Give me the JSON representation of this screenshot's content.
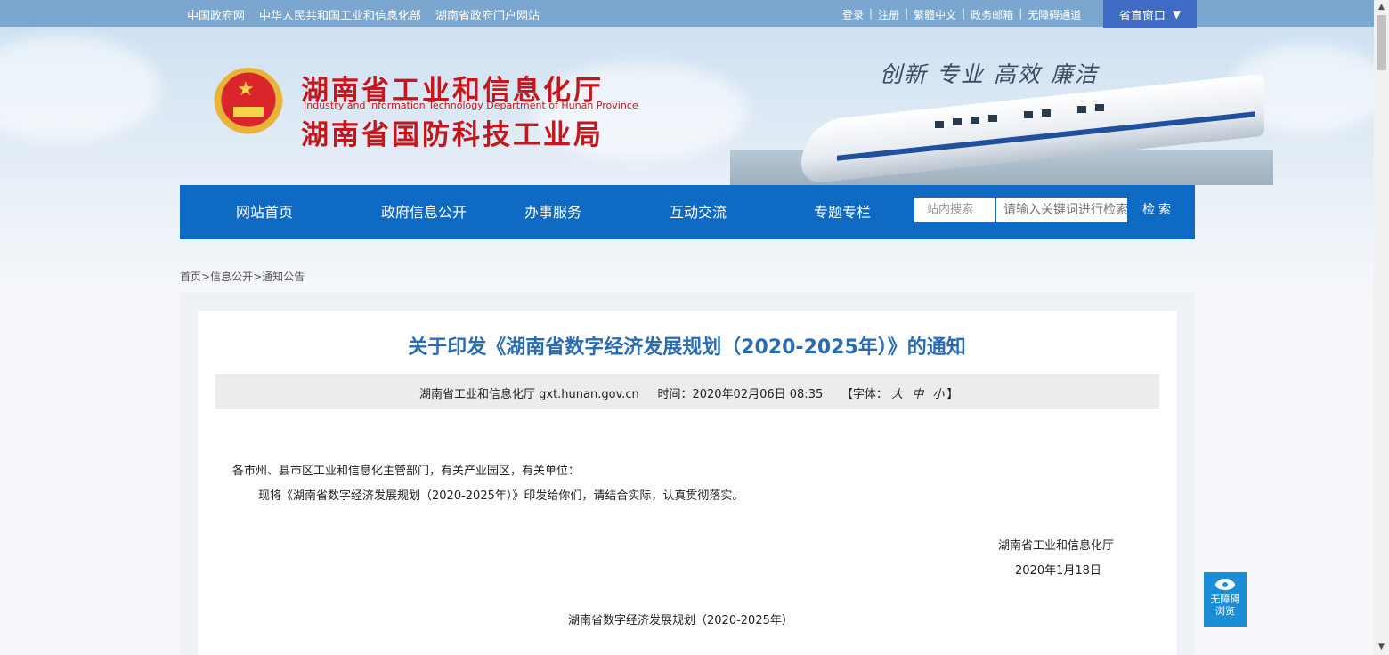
{
  "topbar": {
    "links": [
      "中国政府网",
      "中华人民共和国工业和信息化部",
      "湖南省政府门户网站"
    ],
    "right_links": [
      "登录",
      "注册",
      "繁體中文",
      "政务邮箱",
      "无障碍通道"
    ],
    "separator": "|",
    "province_button": "省直窗口",
    "province_arrow": "▼"
  },
  "header": {
    "title_cn_1": "湖南省工业和信息化厅",
    "title_en": "Industry and Information Technology Department of Hunan Province",
    "title_cn_2": "湖南省国防科技工业局",
    "slogan": "创新 专业 高效 廉洁",
    "emblem_icon": "national-emblem-icon",
    "emblem_star": "★"
  },
  "nav": {
    "items": [
      "网站首页",
      "政府信息公开",
      "办事服务",
      "互动交流",
      "专题专栏"
    ],
    "search_label": "站内搜索",
    "search_placeholder": "请输入关键词进行检索",
    "search_button": "检索"
  },
  "breadcrumb": {
    "home": "首页",
    "sep": ">",
    "level1": "信息公开",
    "level2": "通知公告"
  },
  "article": {
    "title": "关于印发《湖南省数字经济发展规划（2020-2025年）》的通知",
    "source": "湖南省工业和信息化厅 gxt.hunan.gov.cn",
    "time_label": "时间：",
    "time": "2020年02月06日 08:35",
    "font_label_open": "【字体：",
    "font_sizes": "大 中 小",
    "font_label_close": "】",
    "salutation": "各市州、县市区工业和信息化主管部门，有关产业园区，有关单位：",
    "body": "现将《湖南省数字经济发展规划（2020-2025年）》印发给你们，请结合实际，认真贯彻落实。",
    "signature_org": "湖南省工业和信息化厅",
    "signature_date": "2020年1月18日",
    "attachment_title": "湖南省数字经济发展规划（2020-2025年）"
  },
  "accessibility": {
    "icon": "eye-icon",
    "line1": "无障碍",
    "line2": "浏览"
  },
  "colors": {
    "nav_blue": "#0e6ac2",
    "title_red": "#c3171d",
    "article_title_blue": "#2b6cb0",
    "province_button": "#3f6bc5"
  }
}
